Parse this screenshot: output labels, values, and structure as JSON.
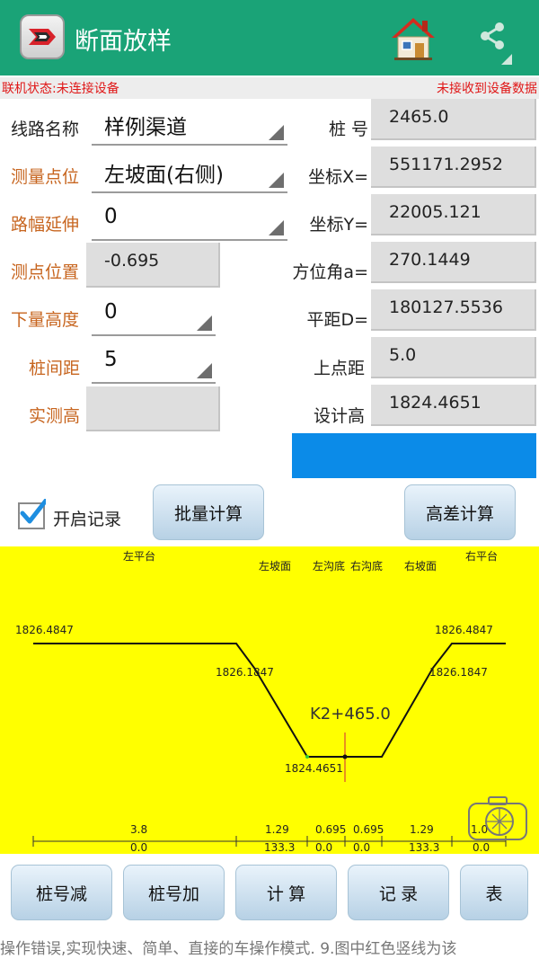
{
  "header": {
    "title": "断面放样",
    "icons": {
      "logo": "app-logo-icon",
      "home": "home-icon",
      "share": "share-icon"
    },
    "colors": {
      "bar": "#1aa377"
    }
  },
  "status": {
    "left": "联机状态:未连接设备",
    "right": "未接收到设备数据",
    "color": "#e01818"
  },
  "form": {
    "line_name": {
      "label": "线路名称",
      "value": "样例渠道"
    },
    "measure_point": {
      "label": "测量点位",
      "value": "左坡面(右侧)"
    },
    "road_extend": {
      "label": "路幅延伸",
      "value": "0"
    },
    "point_pos": {
      "label": "测点位置",
      "value": "-0.695"
    },
    "down_height": {
      "label": "下量高度",
      "value": "0"
    },
    "pile_interval": {
      "label": "桩间距",
      "value": "5"
    },
    "measured_height": {
      "label": "实测高",
      "value": ""
    },
    "pile_no": {
      "label": "桩  号",
      "value": "2465.0"
    },
    "coord_x": {
      "label": "坐标X=",
      "value": "551171.2952"
    },
    "coord_y": {
      "label": "坐标Y=",
      "value": "22005.121"
    },
    "azimuth": {
      "label": "方位角a=",
      "value": "270.1449"
    },
    "distance": {
      "label": "平距D=",
      "value": "180127.5536"
    },
    "prev_dist": {
      "label": "上点距",
      "value": "5.0"
    },
    "design_height": {
      "label": "设计高",
      "value": "1824.4651"
    },
    "accent_colors": {
      "orange": "#c7651f",
      "blue_bar": "#0b8be8"
    }
  },
  "controls": {
    "record_checkbox": {
      "label": "开启记录",
      "checked": true
    },
    "batch_button": "批量计算",
    "diff_button": "高差计算"
  },
  "drawing": {
    "background": "#ffff00",
    "section_labels": [
      "左平台",
      "左坡面",
      "左沟底",
      "右沟底",
      "右坡面",
      "右平台"
    ],
    "elevations": {
      "left_top": "1826.4847",
      "left_mid": "1826.1847",
      "bottom": "1824.4651",
      "right_top": "1826.4847",
      "right_mid": "1826.1847"
    },
    "station": "K2+465.0",
    "widths": [
      "3.8",
      "1.29",
      "0.695",
      "0.695",
      "1.29",
      "1.0"
    ],
    "offsets": [
      "0.0",
      "133.3",
      "0.0",
      "0.0",
      "133.3",
      "0.0"
    ],
    "camera_icon": "camera-icon"
  },
  "bottom_buttons": [
    "桩号减",
    "桩号加",
    "计 算",
    "记 录",
    "表"
  ],
  "caption": "操作错误,实现快速、简单、直接的车操作模式.    9.图中红色竖线为该"
}
